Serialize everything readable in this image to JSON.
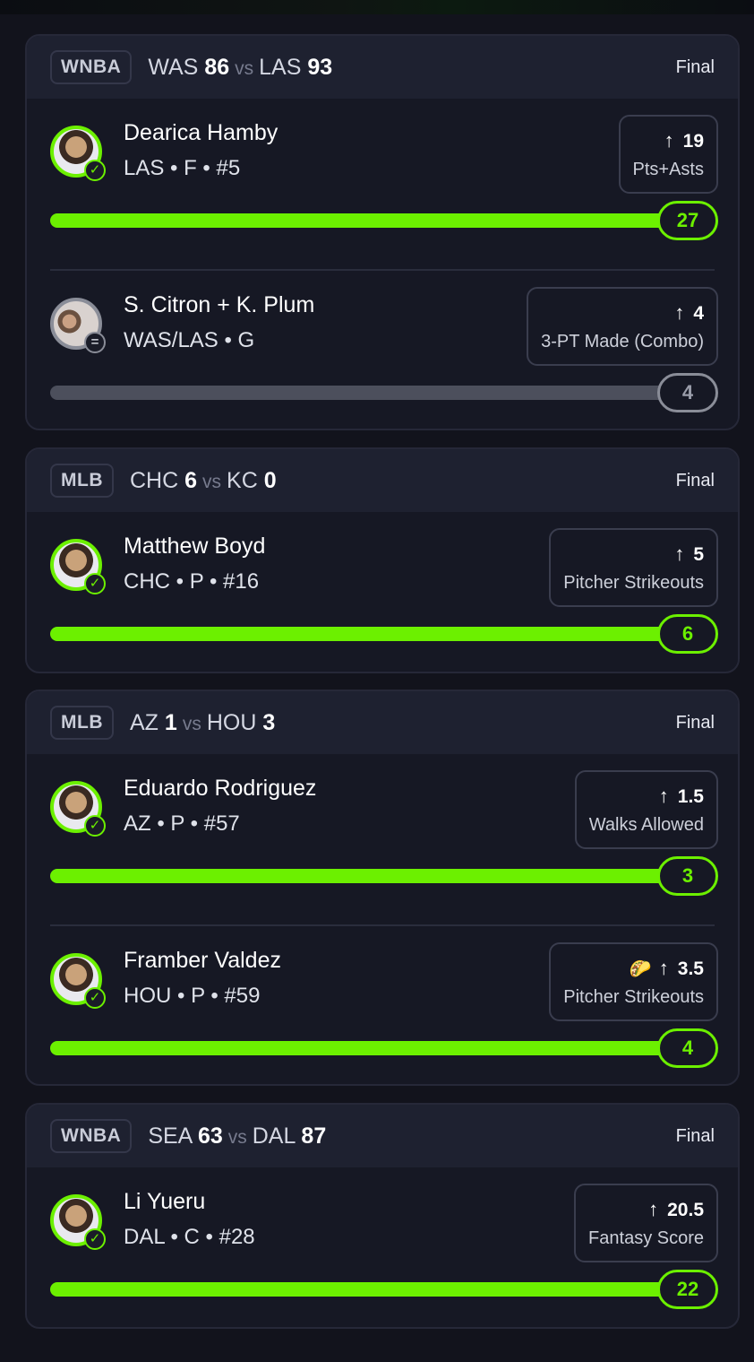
{
  "cards": [
    {
      "league": "WNBA",
      "away_team": "WAS",
      "away_score": "86",
      "vs": "vs",
      "home_team": "LAS",
      "home_score": "93",
      "status": "Final",
      "picks": [
        {
          "name": "Dearica Hamby",
          "meta": "LAS • F • #5",
          "line": "19",
          "stat": "Pts+Asts",
          "result": "27",
          "state": "hit",
          "badge": "✓"
        },
        {
          "name": "S. Citron + K. Plum",
          "meta": "WAS/LAS • G",
          "line": "4",
          "stat": "3-PT Made (Combo)",
          "result": "4",
          "state": "push",
          "badge": "="
        }
      ]
    },
    {
      "league": "MLB",
      "away_team": "CHC",
      "away_score": "6",
      "vs": "vs",
      "home_team": "KC",
      "home_score": "0",
      "status": "Final",
      "picks": [
        {
          "name": "Matthew Boyd",
          "meta": "CHC • P • #16",
          "line": "5",
          "stat": "Pitcher Strikeouts",
          "result": "6",
          "state": "hit",
          "badge": "✓"
        }
      ]
    },
    {
      "league": "MLB",
      "away_team": "AZ",
      "away_score": "1",
      "vs": "vs",
      "home_team": "HOU",
      "home_score": "3",
      "status": "Final",
      "picks": [
        {
          "name": "Eduardo Rodriguez",
          "meta": "AZ • P • #57",
          "line": "1.5",
          "stat": "Walks Allowed",
          "result": "3",
          "state": "hit",
          "badge": "✓"
        },
        {
          "name": "Framber Valdez",
          "meta": "HOU • P • #59",
          "line": "3.5",
          "stat": "Pitcher Strikeouts",
          "result": "4",
          "state": "hit",
          "badge": "✓",
          "emoji": "🌮"
        }
      ]
    },
    {
      "league": "WNBA",
      "away_team": "SEA",
      "away_score": "63",
      "vs": "vs",
      "home_team": "DAL",
      "home_score": "87",
      "status": "Final",
      "picks": [
        {
          "name": "Li Yueru",
          "meta": "DAL • C • #28",
          "line": "20.5",
          "stat": "Fantasy Score",
          "result": "22",
          "state": "hit",
          "badge": "✓"
        }
      ]
    }
  ],
  "icons": {
    "direction": "arrow-up-icon",
    "hit": "check-icon",
    "push": "equals-icon"
  },
  "colors": {
    "accent": "#6cf000",
    "push": "#8a8d98",
    "background": "#12131c"
  }
}
